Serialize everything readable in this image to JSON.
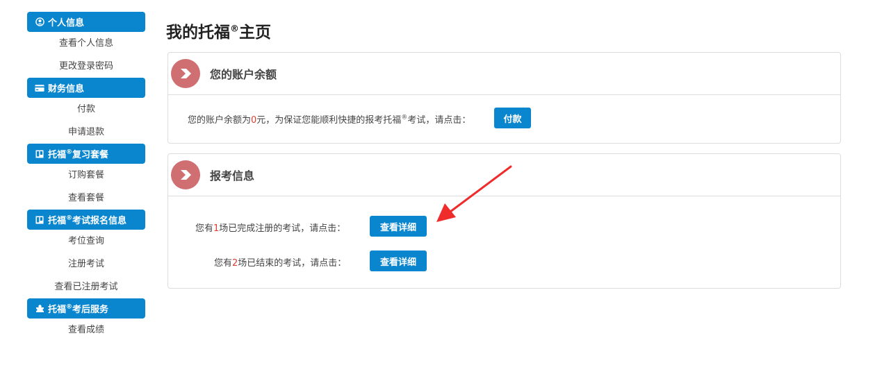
{
  "sidebar": {
    "groups": [
      {
        "head": "个人信息",
        "icon": "user-circle-icon",
        "items": [
          "查看个人信息",
          "更改登录密码"
        ]
      },
      {
        "head": "财务信息",
        "icon": "credit-card-icon",
        "items": [
          "付款",
          "申请退款"
        ]
      },
      {
        "head_pre": "托福",
        "head_post": "复习套餐",
        "icon": "board-icon",
        "items": [
          "订购套餐",
          "查看套餐"
        ]
      },
      {
        "head_pre": "托福",
        "head_post": "考试报名信息",
        "icon": "board-icon",
        "items": [
          "考位查询",
          "注册考试",
          "查看已注册考试"
        ]
      },
      {
        "head_pre": "托福",
        "head_post": "考后服务",
        "icon": "puzzle-icon",
        "items": [
          "查看成绩"
        ]
      }
    ],
    "reg": "®"
  },
  "page": {
    "title_pre": "我的托福",
    "title_post": "主页",
    "reg": "®"
  },
  "balance_panel": {
    "title": "您的账户余额",
    "text_pre": "您的账户余额为",
    "amount": "0",
    "text_mid": "元，为保证您能顺利快捷的报考托福",
    "text_post": "考试，请点击：",
    "button": "付款"
  },
  "exam_panel": {
    "title": "报考信息",
    "row1": {
      "pre": "您有",
      "count": "1",
      "post": "场已完成注册的考试，请点击：",
      "button": "查看详细"
    },
    "row2": {
      "pre": "您有",
      "count": "2",
      "post": "场已结束的考试，请点击：",
      "button": "查看详细"
    }
  },
  "colors": {
    "primary": "#0a86cf",
    "badge": "#cf6f71",
    "highlight": "#e23b2e",
    "annotation_arrow": "#f02b2b"
  }
}
